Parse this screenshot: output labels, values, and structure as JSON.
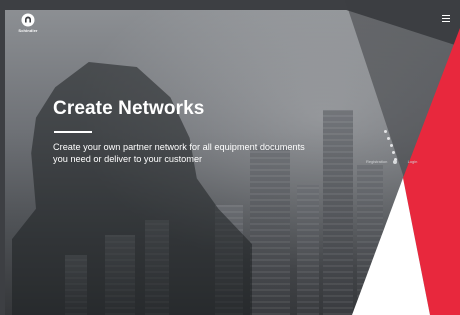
{
  "brand": {
    "name": "Schindler"
  },
  "hero": {
    "title": "Create Networks",
    "description": "Create your own partner network for all equipment documents you need or deliver to your customer"
  },
  "nav": {
    "registration": "Registration",
    "login": "Login"
  },
  "icons": {
    "menu": "hamburger-menu-icon",
    "logo": "schindler-logo-icon"
  },
  "colors": {
    "background": "#3d3f43",
    "accent_red": "#e8283d",
    "text": "#ffffff"
  },
  "slides": {
    "count": 6,
    "active_index": 5
  }
}
